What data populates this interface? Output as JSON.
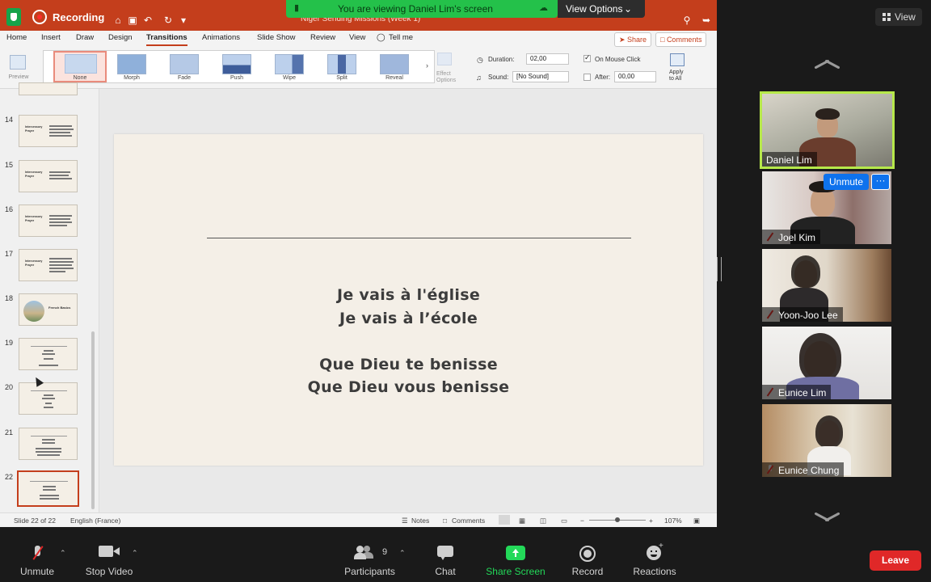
{
  "recording_label": "Recording",
  "banner": {
    "text": "You are viewing Daniel Lim's screen",
    "view_options": "View Options"
  },
  "ppt": {
    "doc_title": "Niger Sending Missions (Week 1)",
    "tabs": [
      "Home",
      "Insert",
      "Draw",
      "Design",
      "Transitions",
      "Animations",
      "Slide Show",
      "Review",
      "View",
      "Tell me"
    ],
    "active_tab": "Transitions",
    "share_label": "Share",
    "comments_label": "Comments",
    "preview_label": "Preview",
    "transitions": [
      "None",
      "Morph",
      "Fade",
      "Push",
      "Wipe",
      "Split",
      "Reveal"
    ],
    "effect_options_label": "Effect\nOptions",
    "duration_label": "Duration:",
    "duration_value": "02,00",
    "sound_label": "Sound:",
    "sound_value": "[No Sound]",
    "on_mouse_click_label": "On Mouse Click",
    "after_label": "After:",
    "after_value": "00,00",
    "apply_all_label": "Apply\nto All",
    "slide_numbers": [
      "14",
      "15",
      "16",
      "17",
      "18",
      "19",
      "20",
      "21",
      "22"
    ],
    "thumb_title": "Intercessory\nPrayer",
    "thumb_18_title": "French Basics",
    "slide_lines": [
      "Je vais à l'église",
      "Je vais à l’école",
      "Que Dieu te benisse",
      "Que Dieu vous benisse"
    ],
    "status_slide": "Slide 22 of 22",
    "status_lang": "English (France)",
    "status_notes": "Notes",
    "status_comments": "Comments",
    "zoom_percent": "107%"
  },
  "participants": [
    {
      "name": "Daniel Lim",
      "muted": false,
      "speaking": true
    },
    {
      "name": "Joel Kim",
      "muted": true
    },
    {
      "name": "Yoon-Joo Lee",
      "muted": true
    },
    {
      "name": "Eunice Lim",
      "muted": true
    },
    {
      "name": "Eunice Chung",
      "muted": true
    }
  ],
  "view_button": "View",
  "unmute_label": "Unmute",
  "more_label": "···",
  "toolbar": {
    "unmute": "Unmute",
    "stop_video": "Stop Video",
    "participants": "Participants",
    "participant_count": "9",
    "chat": "Chat",
    "share_screen": "Share Screen",
    "record": "Record",
    "reactions": "Reactions",
    "leave": "Leave"
  },
  "colors": {
    "ppt_accent": "#c43e1c",
    "banner_green": "#24c14a",
    "share_green": "#23d959",
    "leave_red": "#e02828",
    "speaker_border": "#b6e84a"
  }
}
